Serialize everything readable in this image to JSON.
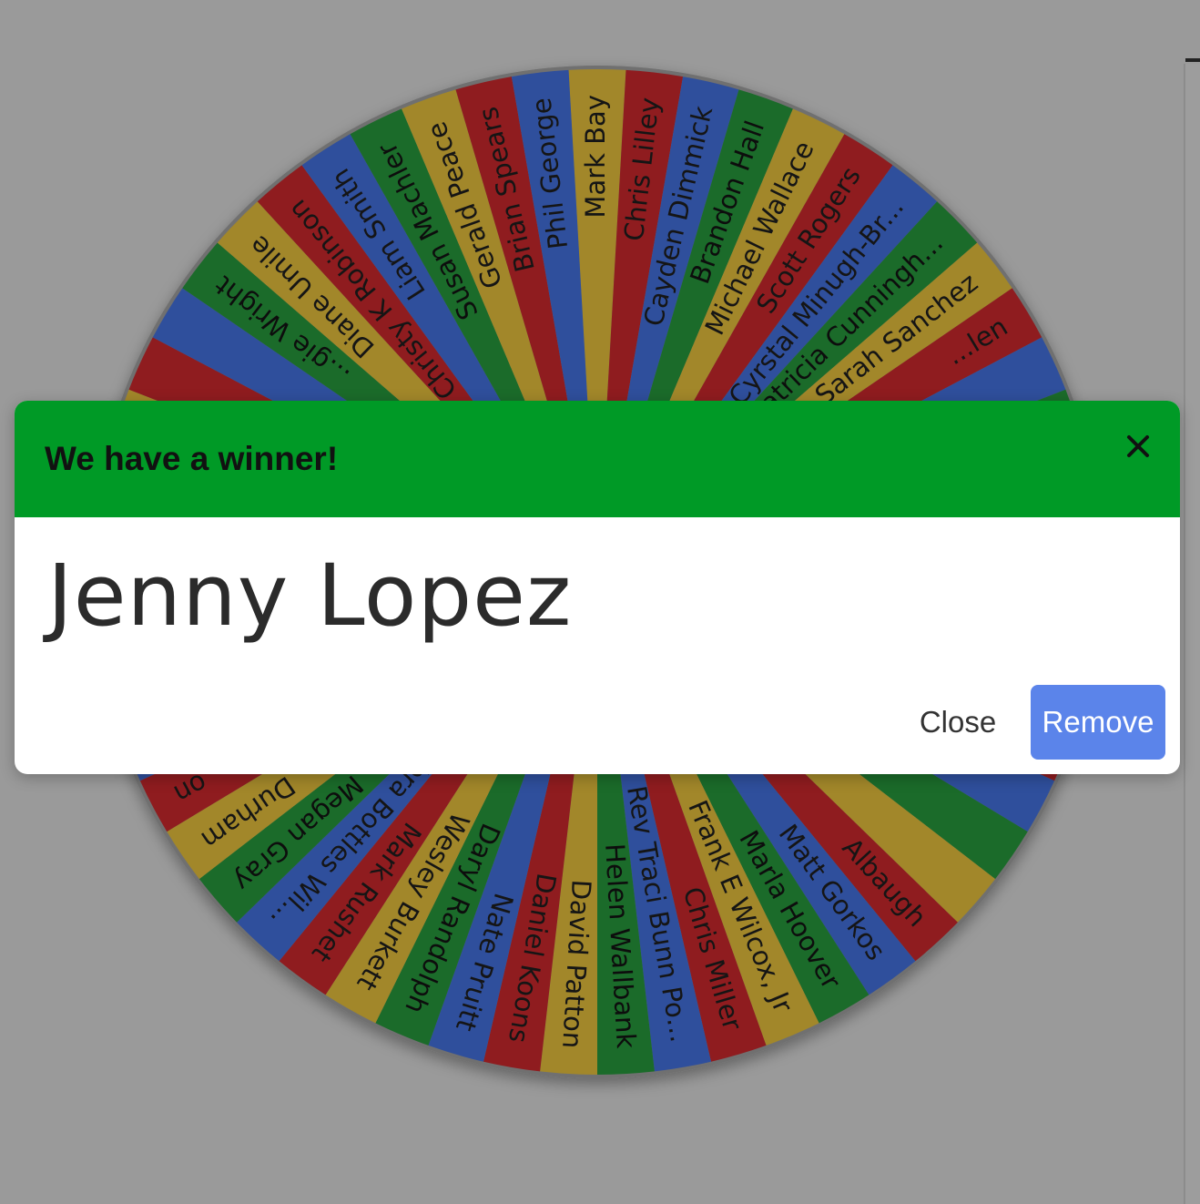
{
  "wheel": {
    "colors": [
      "#a2872a",
      "#8f1c1f",
      "#2f4f9c",
      "#1b6b2a"
    ],
    "segments": [
      "Mark Bay",
      "Chris Lilley",
      "Cayden Dimmick",
      "Brandon Hall",
      "Michael Wallace",
      "Scott Rogers",
      "Cyrstal Minugh-Br...",
      "Patricia Cunningh...",
      "Sarah Sanchez",
      "...len",
      "",
      "",
      "",
      "",
      "",
      "",
      "",
      "",
      "",
      "",
      "",
      "Albaugh",
      "Matt Gorkos",
      "Marla Hoover",
      "Frank E Wilcox, Jr",
      "Chris Miller",
      "Rev Traci Bunn Po...",
      "Helen Wallbank",
      "David Patton",
      "Daniel Koons",
      "Nate Pruitt",
      "Daryl Randolph",
      "Wesley Burkett",
      "Mark Rushet",
      "Debra Bottles Wil...",
      "Megan Gray",
      "... Durham",
      "...on",
      "",
      "",
      "",
      "",
      "",
      "",
      "",
      "",
      "",
      "...gie Wright",
      "Diane Umile",
      "Christy K Robinson",
      "Liam Smith",
      "Susan Machler",
      "Gerald Peace",
      "Brian Spears",
      "Phil George"
    ]
  },
  "modal": {
    "title": "We have a winner!",
    "winner": "Jenny Lopez",
    "close_label": "Close",
    "remove_label": "Remove"
  },
  "icons": {
    "dismiss": "close-icon"
  }
}
